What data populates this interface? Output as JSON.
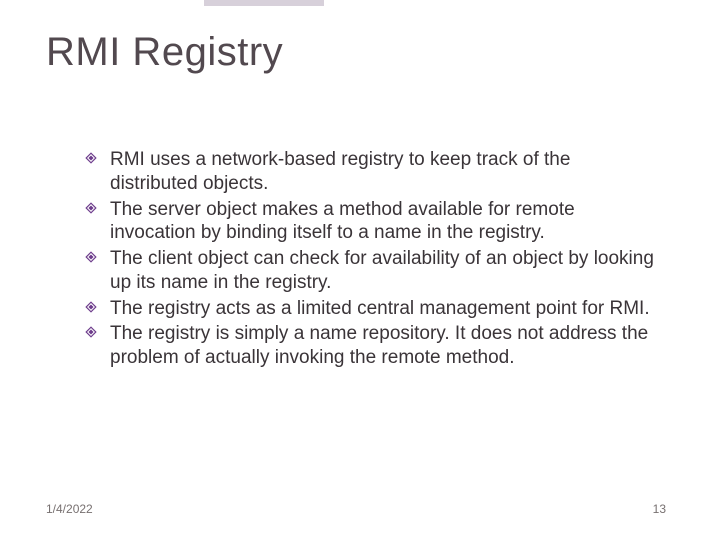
{
  "title": "RMI Registry",
  "bullets": [
    "RMI uses a network-based registry to keep track of the distributed objects.",
    "The server object makes a method available for remote invocation by binding itself to a name in the registry.",
    "The client object can check for availability of an object by looking up its name in the registry.",
    "The registry acts as a limited central management point for RMI.",
    "The registry is simply a name repository. It does not address the problem of  actually invoking the remote method."
  ],
  "footer": {
    "date": "1/4/2022",
    "page": "13"
  },
  "colors": {
    "bullet_diamond": "#6d3c8b",
    "title": "#52494f"
  }
}
